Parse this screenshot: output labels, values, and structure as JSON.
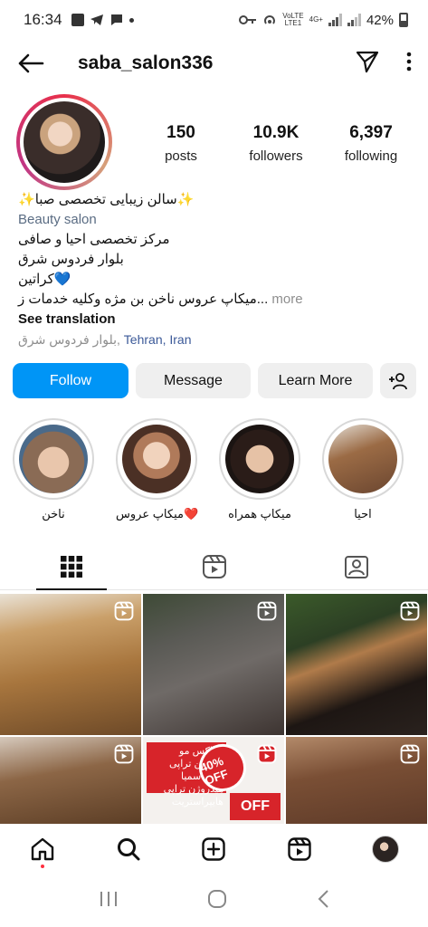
{
  "status_bar": {
    "time": "16:34",
    "battery": "42%",
    "network_top": "4G+",
    "volte_top": "VoLTE",
    "lte": "LTE1"
  },
  "header": {
    "username": "saba_salon336",
    "back_icon": "arrow-left-icon",
    "send_icon": "paper-plane-icon",
    "menu_icon": "more-vertical-icon"
  },
  "profile": {
    "posts_count": "150",
    "posts_label": "posts",
    "followers_count": "10.9K",
    "followers_label": "followers",
    "following_count": "6,397",
    "following_label": "following"
  },
  "bio": {
    "name": "✨سالن زیبایی تخصصی صبا✨",
    "category": "Beauty salon",
    "line1": "مرکز تخصصی احیا و صافی",
    "line2": "بلوار فردوس شرق",
    "line3": "کراتین💙",
    "line4": "میکاپ عروس ناخن بن مژه وکلیه خدمات ز...",
    "more_label": "more",
    "see_translation": "See translation",
    "location_street": "بلوار فردوس شرق",
    "location_city": "Tehran, Iran"
  },
  "actions": {
    "follow": "Follow",
    "message": "Message",
    "learn_more": "Learn More",
    "add_person_icon": "add-person-icon"
  },
  "highlights": [
    {
      "caption": "ناخن"
    },
    {
      "caption": "میکاپ عروس❤️"
    },
    {
      "caption": "میکاپ همراه"
    },
    {
      "caption": "احیا"
    }
  ],
  "tabs": [
    {
      "icon": "grid-icon",
      "active": true
    },
    {
      "icon": "reels-icon",
      "active": false
    },
    {
      "icon": "tagged-icon",
      "active": false
    }
  ],
  "grid": {
    "promo_text": "بوتاکس مو پروتئین تراپی نانوپلاسمیا هیدروژن تراپی هایپراستریت",
    "promo_badge": "40% OFF",
    "promo_off": "OFF"
  },
  "bottom_nav": [
    "home-icon",
    "search-icon",
    "create-icon",
    "reels-icon",
    "profile-avatar"
  ],
  "colors": {
    "accent_blue": "#0095f6",
    "button_gray": "#efefef",
    "category_text": "#5a6c83",
    "promo_red": "#d7242a"
  }
}
